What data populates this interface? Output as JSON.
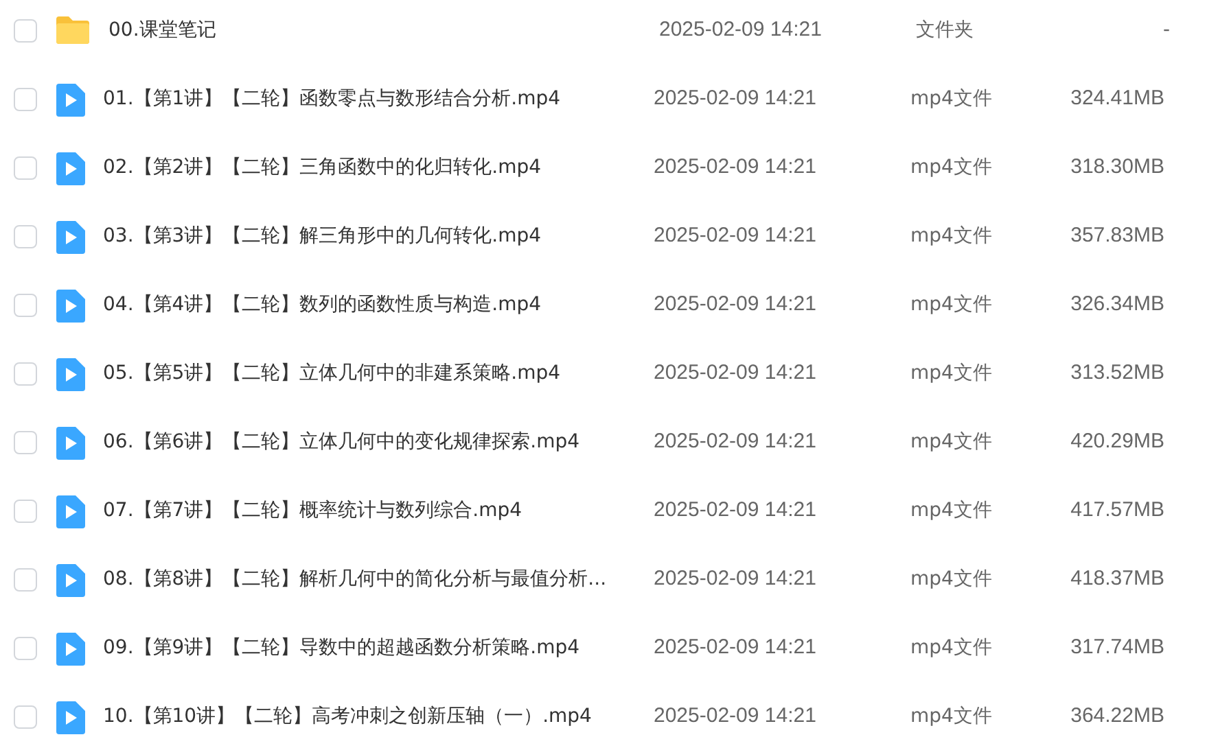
{
  "files": [
    {
      "kind": "folder",
      "checked": false,
      "name": "00.课堂笔记",
      "modified": "2025-02-09 14:21",
      "type": "文件夹",
      "size": "-"
    },
    {
      "kind": "video",
      "checked": false,
      "name": "01.【第1讲】【二轮】函数零点与数形结合分析.mp4",
      "modified": "2025-02-09 14:21",
      "type": "mp4文件",
      "size": "324.41MB"
    },
    {
      "kind": "video",
      "checked": false,
      "name": "02.【第2讲】【二轮】三角函数中的化归转化.mp4",
      "modified": "2025-02-09 14:21",
      "type": "mp4文件",
      "size": "318.30MB"
    },
    {
      "kind": "video",
      "checked": false,
      "name": "03.【第3讲】【二轮】解三角形中的几何转化.mp4",
      "modified": "2025-02-09 14:21",
      "type": "mp4文件",
      "size": "357.83MB"
    },
    {
      "kind": "video",
      "checked": false,
      "name": "04.【第4讲】【二轮】数列的函数性质与构造.mp4",
      "modified": "2025-02-09 14:21",
      "type": "mp4文件",
      "size": "326.34MB"
    },
    {
      "kind": "video",
      "checked": false,
      "name": "05.【第5讲】【二轮】立体几何中的非建系策略.mp4",
      "modified": "2025-02-09 14:21",
      "type": "mp4文件",
      "size": "313.52MB"
    },
    {
      "kind": "video",
      "checked": false,
      "name": "06.【第6讲】【二轮】立体几何中的变化规律探索.mp4",
      "modified": "2025-02-09 14:21",
      "type": "mp4文件",
      "size": "420.29MB"
    },
    {
      "kind": "video",
      "checked": false,
      "name": "07.【第7讲】【二轮】概率统计与数列综合.mp4",
      "modified": "2025-02-09 14:21",
      "type": "mp4文件",
      "size": "417.57MB"
    },
    {
      "kind": "video",
      "checked": false,
      "name": "08.【第8讲】【二轮】解析几何中的简化分析与最值分析...",
      "modified": "2025-02-09 14:21",
      "type": "mp4文件",
      "size": "418.37MB"
    },
    {
      "kind": "video",
      "checked": false,
      "name": "09.【第9讲】【二轮】导数中的超越函数分析策略.mp4",
      "modified": "2025-02-09 14:21",
      "type": "mp4文件",
      "size": "317.74MB"
    },
    {
      "kind": "video",
      "checked": false,
      "name": "10.【第10讲】【二轮】高考冲刺之创新压轴（一）.mp4",
      "modified": "2025-02-09 14:21",
      "type": "mp4文件",
      "size": "364.22MB"
    }
  ]
}
